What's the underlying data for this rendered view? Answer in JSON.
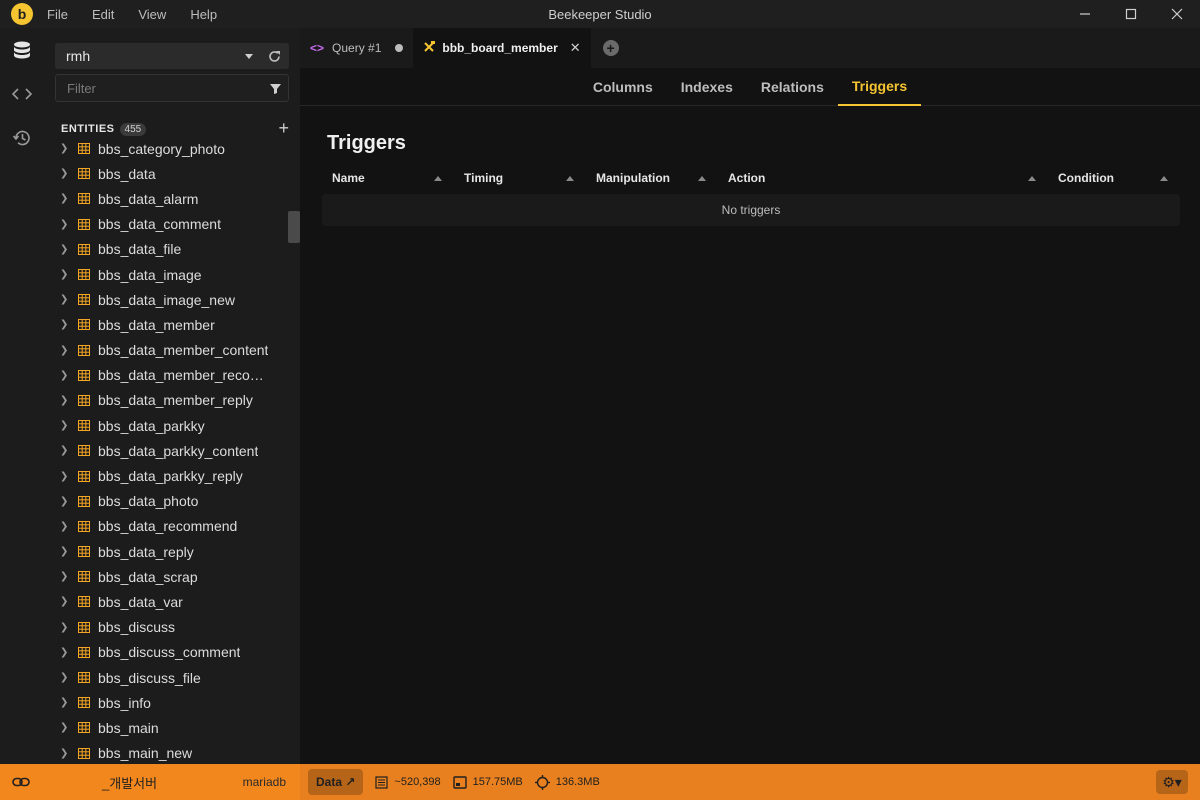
{
  "titlebar": {
    "menu": [
      "File",
      "Edit",
      "View",
      "Help"
    ],
    "title": "Beekeeper Studio"
  },
  "sidebar": {
    "connection": "rmh",
    "filter_placeholder": "Filter",
    "entities_label": "ENTITIES",
    "entities_count": "455",
    "entities": [
      "bbs_category_photo",
      "bbs_data",
      "bbs_data_alarm",
      "bbs_data_comment",
      "bbs_data_file",
      "bbs_data_image",
      "bbs_data_image_new",
      "bbs_data_member",
      "bbs_data_member_content",
      "bbs_data_member_recom...",
      "bbs_data_member_reply",
      "bbs_data_parkky",
      "bbs_data_parkky_content",
      "bbs_data_parkky_reply",
      "bbs_data_photo",
      "bbs_data_recommend",
      "bbs_data_reply",
      "bbs_data_scrap",
      "bbs_data_var",
      "bbs_discuss",
      "bbs_discuss_comment",
      "bbs_discuss_file",
      "bbs_info",
      "bbs_main",
      "bbs_main_new"
    ]
  },
  "tabs": [
    {
      "label": "Query #1",
      "icon": "code-icon"
    },
    {
      "label": "bbb_board_member",
      "icon": "tools-icon"
    }
  ],
  "subtabs": [
    "Columns",
    "Indexes",
    "Relations",
    "Triggers"
  ],
  "active_subtab": "Triggers",
  "main": {
    "title": "Triggers",
    "columns": [
      "Name",
      "Timing",
      "Manipulation",
      "Action",
      "Condition"
    ],
    "empty_text": "No triggers"
  },
  "statusbar": {
    "connection_name": "_개발서버",
    "db_type": "mariadb",
    "data_label": "Data ↗",
    "rows": "~520,398",
    "table_size": "157.75MB",
    "index_size": "136.3MB"
  },
  "colors": {
    "accent": "#f5c431",
    "status_bar": "#e8801f",
    "table_icon": "#f5a623"
  }
}
